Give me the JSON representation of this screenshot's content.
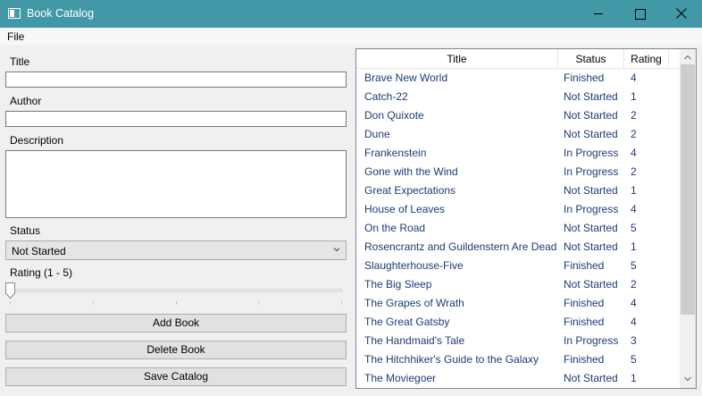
{
  "window": {
    "title": "Book Catalog",
    "icon": "app-window-icon",
    "controls": [
      "minimize-icon",
      "maximize-icon",
      "close-icon"
    ]
  },
  "menu": {
    "file": "File"
  },
  "form": {
    "title_label": "Title",
    "title_value": "",
    "author_label": "Author",
    "author_value": "",
    "description_label": "Description",
    "description_value": "",
    "status_label": "Status",
    "status_value": "Not Started",
    "rating_label": "Rating (1 - 5)",
    "rating_value": 1,
    "rating_min": 1,
    "rating_max": 5
  },
  "buttons": {
    "add": "Add Book",
    "delete": "Delete Book",
    "save": "Save Catalog"
  },
  "list": {
    "columns": [
      "Title",
      "Status",
      "Rating"
    ],
    "rows": [
      {
        "title": "Brave New World",
        "status": "Finished",
        "rating": "4"
      },
      {
        "title": "Catch-22",
        "status": "Not Started",
        "rating": "1"
      },
      {
        "title": "Don Quixote",
        "status": "Not Started",
        "rating": "2"
      },
      {
        "title": "Dune",
        "status": "Not Started",
        "rating": "2"
      },
      {
        "title": "Frankenstein",
        "status": "In Progress",
        "rating": "4"
      },
      {
        "title": "Gone with the Wind",
        "status": "In Progress",
        "rating": "2"
      },
      {
        "title": "Great Expectations",
        "status": "Not Started",
        "rating": "1"
      },
      {
        "title": "House of Leaves",
        "status": "In Progress",
        "rating": "4"
      },
      {
        "title": "On the Road",
        "status": "Not Started",
        "rating": "5"
      },
      {
        "title": "Rosencrantz and Guildenstern Are Dead",
        "status": "Not Started",
        "rating": "1"
      },
      {
        "title": "Slaughterhouse-Five",
        "status": "Finished",
        "rating": "5"
      },
      {
        "title": "The Big Sleep",
        "status": "Not Started",
        "rating": "2"
      },
      {
        "title": "The Grapes of Wrath",
        "status": "Finished",
        "rating": "4"
      },
      {
        "title": "The Great Gatsby",
        "status": "Finished",
        "rating": "4"
      },
      {
        "title": "The Handmaid's Tale",
        "status": "In Progress",
        "rating": "3"
      },
      {
        "title": "The Hitchhiker's Guide to the Galaxy",
        "status": "Finished",
        "rating": "5"
      },
      {
        "title": "The Moviegoer",
        "status": "Not Started",
        "rating": "1"
      }
    ]
  },
  "colors": {
    "titlebar": "#4398a8",
    "row_text": "#1d3b75",
    "window_bg": "#f0f0f0"
  }
}
